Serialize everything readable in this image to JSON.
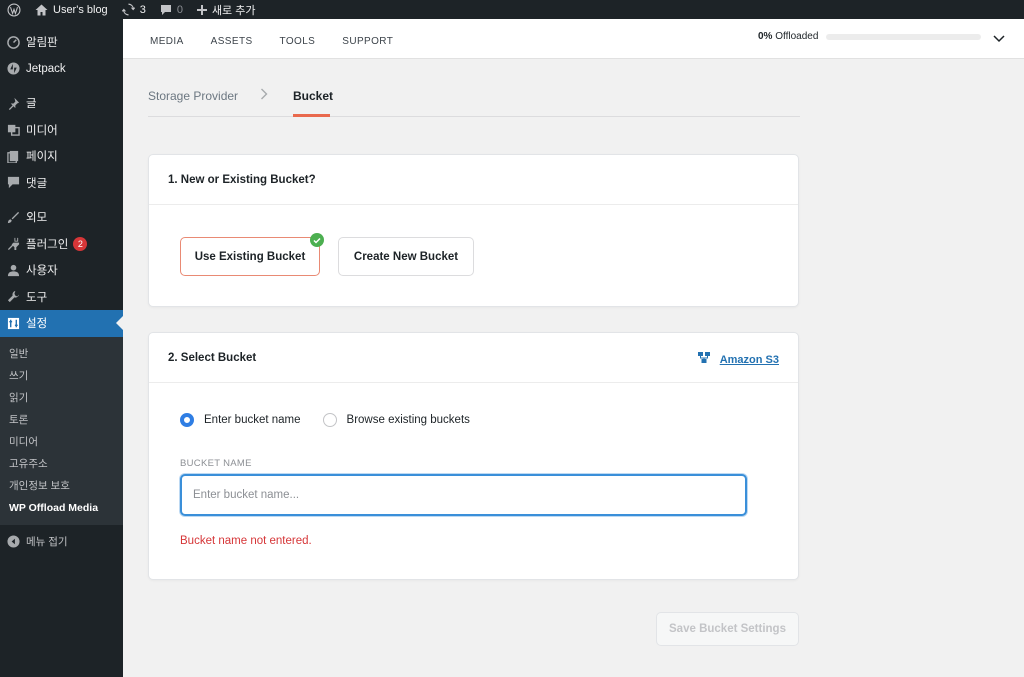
{
  "admin_bar": {
    "wp_logo": "wordpress-icon",
    "site_name": "User's blog",
    "updates_count": "3",
    "comments_count": "0",
    "new_label": "새로 추가"
  },
  "sidebar": {
    "items": [
      {
        "label": "알림판",
        "icon": "dashboard-icon"
      },
      {
        "label": "Jetpack",
        "icon": "jetpack-icon"
      },
      {
        "label": "글",
        "icon": "pin-icon"
      },
      {
        "label": "미디어",
        "icon": "media-icon"
      },
      {
        "label": "페이지",
        "icon": "page-icon"
      },
      {
        "label": "댓글",
        "icon": "comment-icon"
      },
      {
        "label": "외모",
        "icon": "appearance-icon"
      },
      {
        "label": "플러그인",
        "icon": "plugin-icon",
        "badge": "2"
      },
      {
        "label": "사용자",
        "icon": "user-icon"
      },
      {
        "label": "도구",
        "icon": "wrench-icon"
      },
      {
        "label": "설정",
        "icon": "settings-icon"
      }
    ],
    "submenu": [
      "일반",
      "쓰기",
      "읽기",
      "토론",
      "미디어",
      "고유주소",
      "개인정보 보호",
      "WP Offload Media"
    ],
    "collapse_label": "메뉴 접기"
  },
  "top_nav": {
    "tabs": [
      "MEDIA",
      "ASSETS",
      "TOOLS",
      "SUPPORT"
    ],
    "offload_percent": "0%",
    "offload_label": "Offloaded",
    "offload_fraction": 0
  },
  "steps": {
    "step1": "Storage Provider",
    "step2": "Bucket"
  },
  "panel1": {
    "title": "1. New or Existing Bucket?",
    "use_existing": "Use Existing Bucket",
    "create_new": "Create New Bucket"
  },
  "panel2": {
    "title": "2. Select Bucket",
    "provider": "Amazon S3",
    "radio_enter": "Enter bucket name",
    "radio_browse": "Browse existing buckets",
    "field_label": "BUCKET NAME",
    "input_placeholder": "Enter bucket name...",
    "input_value": "",
    "error": "Bucket name not entered."
  },
  "save_button": "Save Bucket Settings",
  "colors": {
    "wp_blue": "#2271b1",
    "accent_orange": "#e9694d",
    "error_red": "#d63638",
    "radio_blue": "#2f7ee4",
    "check_green": "#4caf50"
  }
}
